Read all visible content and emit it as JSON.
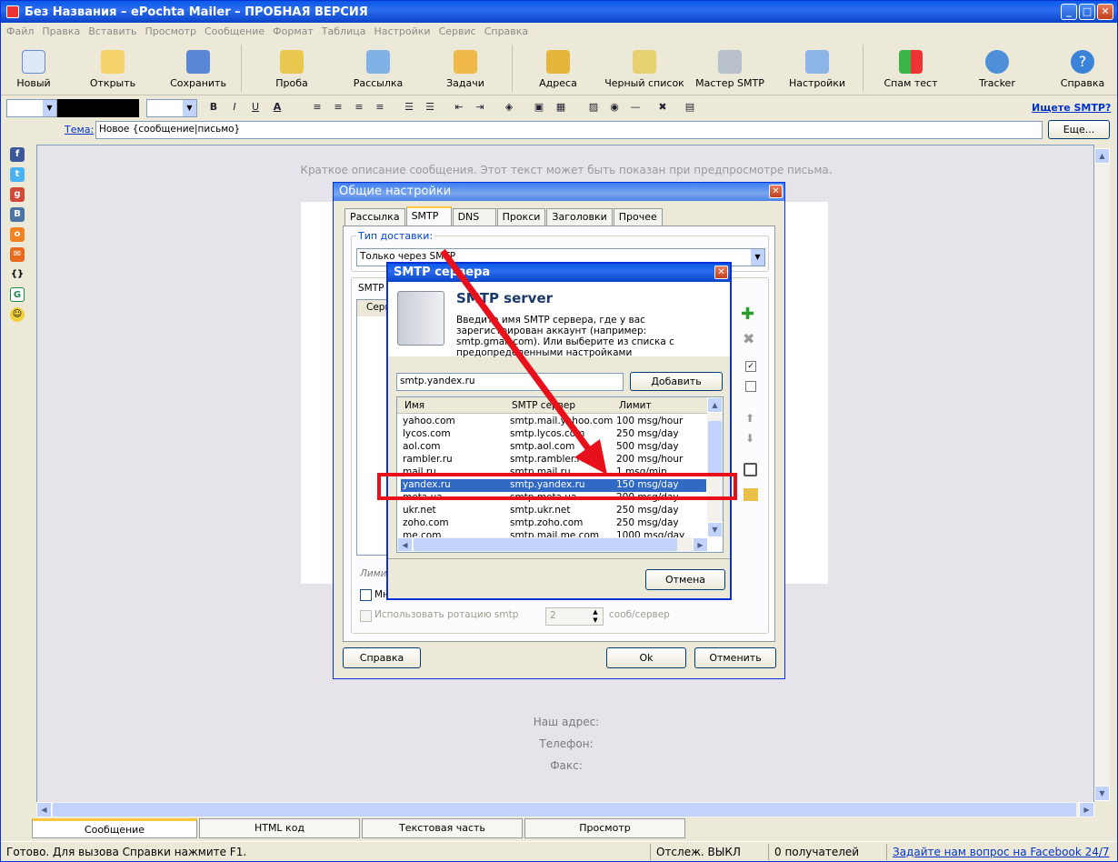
{
  "window": {
    "title": "Без Названия – ePochta Mailer – ПРОБНАЯ ВЕРСИЯ"
  },
  "menu": [
    "Файл",
    "Правка",
    "Вставить",
    "Просмотр",
    "Сообщение",
    "Формат",
    "Таблица",
    "Настройки",
    "Сервис",
    "Справка"
  ],
  "toolbar": {
    "new": "Новый",
    "open": "Открыть",
    "save": "Сохранить",
    "test": "Проба",
    "send": "Рассылка",
    "tasks": "Задачи",
    "addresses": "Адреса",
    "blacklist": "Черный список",
    "smtp_master": "Мастер SMTP",
    "settings": "Настройки",
    "spam_test": "Спам тест",
    "tracker": "Tracker",
    "help": "Справка"
  },
  "format_bar": {
    "smtp_link": "Ищете SMTP?"
  },
  "subject": {
    "label": "Тема:",
    "value": "Новое {сообщение|письмо}",
    "more_button": "Еще..."
  },
  "editor": {
    "preview_text": "Краткое описание сообщения. Этот текст может быть показан при предпросмотре письма.",
    "address_label": "Наш адрес:",
    "phone_label": "Телефон:",
    "fax_label": "Факс:"
  },
  "bottom_tabs": [
    "Сообщение",
    "HTML код",
    "Текстовая часть",
    "Просмотр"
  ],
  "status": {
    "ready": "Готово. Для вызова Справки нажмите F1.",
    "tracking": "Отслеж. ВЫКЛ",
    "recipients": "0 получателей",
    "facebook_link": "Задайте нам вопрос на Facebook 24/7"
  },
  "general_dialog": {
    "title": "Общие настройки",
    "tabs": [
      "Рассылка",
      "SMTP",
      "DNS",
      "Прокси",
      "Заголовки",
      "Прочее"
    ],
    "active_tab": "SMTP",
    "delivery_group": "Тип доставки:",
    "delivery_value": "Только через SMTP",
    "smtp_group": "SMTP с",
    "server_col": "Серв",
    "limit_label": "Лими",
    "multi_label": "Мн",
    "rotation_label": "Использовать ротацию smtp",
    "rotation_value": "2",
    "rotation_unit": "сооб/сервер",
    "help_button": "Справка",
    "ok_button": "Ok",
    "cancel_button": "Отменить"
  },
  "smtp_dialog": {
    "title": "SMTP сервера",
    "heading": "SMTP server",
    "description": "Введите имя SMTP сервера, где у вас зарегистрирован аккаунт (например: smtp.gmail.com). Или выберите из списка с предопределенными настройками",
    "input_value": "smtp.yandex.ru",
    "add_button": "Добавить",
    "columns": [
      "Имя",
      "SMTP сервер",
      "Лимит"
    ],
    "rows": [
      [
        "yahoo.com",
        "smtp.mail.yahoo.com",
        "100 msg/hour"
      ],
      [
        "lycos.com",
        "smtp.lycos.com",
        "250 msg/day"
      ],
      [
        "aol.com",
        "smtp.aol.com",
        "500 msg/day"
      ],
      [
        "rambler.ru",
        "smtp.rambler.ru",
        "200 msg/hour"
      ],
      [
        "mail.ru",
        "smtp.mail.ru",
        "1 msg/min"
      ],
      [
        "yandex.ru",
        "smtp.yandex.ru",
        "150 msg/day"
      ],
      [
        "meta.ua",
        "smtp.meta.ua",
        "200 msg/day"
      ],
      [
        "ukr.net",
        "smtp.ukr.net",
        "250 msg/day"
      ],
      [
        "zoho.com",
        "smtp.zoho.com",
        "250 msg/day"
      ],
      [
        "me.com",
        "smtp.mail.me.com",
        "1000 msg/day"
      ]
    ],
    "selected_row": "yandex.ru",
    "cancel_button": "Отмена"
  },
  "colors": {
    "xp_blue": "#0a5ae6",
    "selection": "#316ac5",
    "highlight_red": "#e8101a"
  }
}
